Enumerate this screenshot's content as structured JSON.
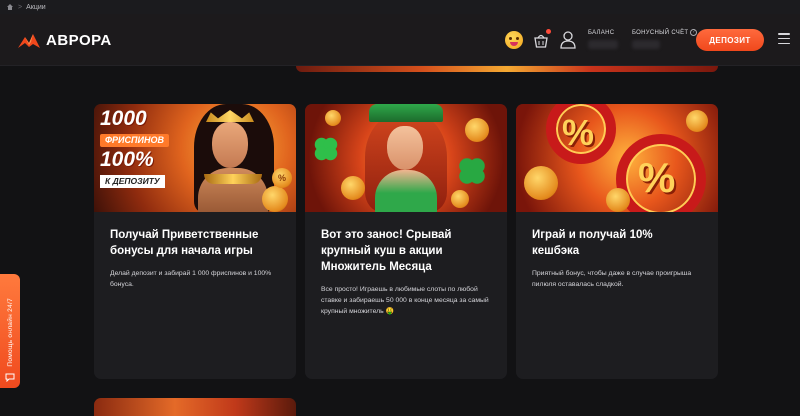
{
  "breadcrumb": {
    "home_icon": "home-icon",
    "separator": ">",
    "current": "Акции"
  },
  "header": {
    "logo_text": "АВРОРА",
    "balance_label": "БАЛАНС",
    "bonus_label": "БОНУСНЫЙ СЧЁТ",
    "bonus_help": "?",
    "deposit_button": "ДЕПОЗИТ",
    "icons": [
      "emoji-face-icon",
      "gift-basket-icon",
      "user-icon",
      "menu-icon"
    ],
    "accent_color": "#f0481c"
  },
  "promos": [
    {
      "banner": {
        "line1": "1000",
        "line2": "ФРИСПИНОВ",
        "line3": "100%",
        "line4": "К ДЕПОЗИТУ",
        "coin_mark": "%"
      },
      "title": "Получай Приветственные бонусы для начала игры",
      "description": "Делай депозит и забирай 1 000 фриспинов и 100% бонуса."
    },
    {
      "title": "Вот это занос! Срывай крупный куш в акции Множитель Месяца",
      "description": "Все просто! Играешь в любимые слоты по любой ставке и забираешь 50 000    в конце месяца за самый крупный множитель 🤑"
    },
    {
      "title": "Играй и получай 10% кешбэка",
      "description": "Приятный бонус, чтобы даже в случае проигрыша пилюля оставалась сладкой."
    }
  ],
  "help_tab": {
    "label": "Помощь онлайн 24/7",
    "icon": "chat-icon"
  }
}
